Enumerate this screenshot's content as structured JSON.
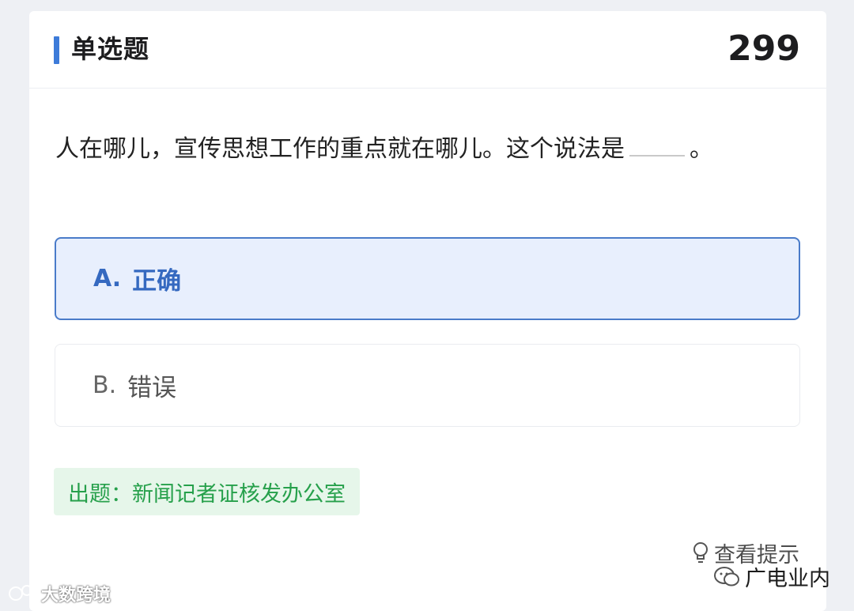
{
  "header": {
    "title": "单选题",
    "number": "299"
  },
  "question": {
    "text_before": "人在哪儿，宣传思想工作的重点就在哪儿。这个说法是",
    "text_after": "。"
  },
  "options": [
    {
      "letter": "A.",
      "label": "正确",
      "selected": true
    },
    {
      "letter": "B.",
      "label": "错误",
      "selected": false
    }
  ],
  "source": {
    "label": "出题：新闻记者证核发办公室"
  },
  "hint": {
    "label": "查看提示",
    "icon": "lightbulb-icon"
  },
  "watermarks": {
    "left": "大数跨境",
    "right": "广电业内"
  },
  "colors": {
    "accent": "#3d7bd9",
    "selected_bg": "#e8effd",
    "source_green": "#26a04b",
    "source_bg": "#e6f6ea"
  }
}
